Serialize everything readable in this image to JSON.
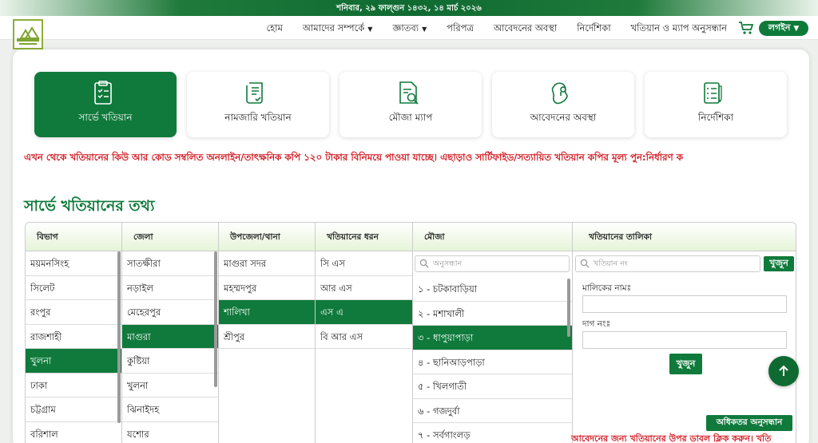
{
  "header": {
    "date": "শনিবার, ২৯ ফাল্গুন ১৪৩২, ১৪ মার্চ ২০২৬",
    "nav": [
      {
        "label": "হোম",
        "dropdown": false
      },
      {
        "label": "আমাদের সম্পর্কে",
        "dropdown": true
      },
      {
        "label": "জ্ঞাতব্য",
        "dropdown": true
      },
      {
        "label": "পরিপত্র",
        "dropdown": false
      },
      {
        "label": "আবেদনের অবস্থা",
        "dropdown": false
      },
      {
        "label": "নির্দেশিকা",
        "dropdown": false
      },
      {
        "label": "খতিয়ান ও ম্যাপ অনুসন্ধান",
        "dropdown": false
      }
    ],
    "login_label": "লগইন"
  },
  "cards": [
    {
      "label": "সার্ভে খতিয়ান",
      "active": true,
      "icon": "survey-clipboard-icon"
    },
    {
      "label": "নামজারি খতিয়ান",
      "active": false,
      "icon": "mutation-scroll-icon"
    },
    {
      "label": "মৌজা ম্যাপ",
      "active": false,
      "icon": "map-search-icon"
    },
    {
      "label": "আবেদনের অবস্থা",
      "active": false,
      "icon": "location-map-icon"
    },
    {
      "label": "নির্দেশিকা",
      "active": false,
      "icon": "checklist-icon"
    }
  ],
  "ticker": "এখন থেকে খতিয়ানের কিউ আর কোড সম্বলিত অনলাইন/তাৎক্ষনিক কপি ১২০ টাকার বিনিময়ে পাওয়া যাচ্ছে। এছাড়াও সার্টিফাইড/সত্যায়িত খতিয়ান কপির মূল্য পুন:নির্ধারণ ক",
  "section_title": "সার্ভে খতিয়ানের তথ্য",
  "columns": {
    "division": {
      "header": "বিভাগ",
      "items": [
        "ময়মনসিংহ",
        "সিলেট",
        "রংপুর",
        "রাজশাহী",
        "খুলনা",
        "ঢাকা",
        "চট্টগ্রাম",
        "বরিশাল"
      ],
      "selected": 4
    },
    "district": {
      "header": "জেলা",
      "items": [
        "সাতক্ষীরা",
        "নড়াইল",
        "মেহেরপুর",
        "মাগুরা",
        "কুষ্টিয়া",
        "খুলনা",
        "ঝিনাইদহ",
        "যশোর"
      ],
      "selected": 3
    },
    "upazila": {
      "header": "উপজেলা/থানা",
      "items": [
        "মাগুরা সদর",
        "মহম্মদপুর",
        "শালিখা",
        "শ্রীপুর"
      ],
      "selected": 2
    },
    "type": {
      "header": "খতিয়ানের ধরন",
      "items": [
        "সি এস",
        "আর এস",
        "এস এ",
        "বি আর এস"
      ],
      "selected": 2
    },
    "mouza": {
      "header": "মৌজা",
      "search_placeholder": "অনুসন্ধান",
      "items": [
        "১ - চটকাবাড়িয়া",
        "২ - মশাখালী",
        "৩ - ধাপুয়াপাড়া",
        "৪ - ছানিআড়পাড়া",
        "৫ - খিলগাতী",
        "৬ - গজদুর্বা",
        "৭ - সর্বগাংলড়"
      ],
      "selected": 2
    },
    "khatian": {
      "header": "খতিয়ানের তালিকা",
      "search_placeholder": "খতিয়ান নং",
      "search_button": "খুজুন",
      "owner_label": "মালিকের নামঃ",
      "dag_label": "দাগ নংঃ",
      "submit_button": "খুজুন",
      "advanced_button": "অধিকতর অনুসন্ধান"
    }
  },
  "double_click_hint": "আবেদনের জন্য খতিয়ানের উপর ডাবল ক্লিক করুন। খতি",
  "colors": {
    "brand_green": "#0f7a3b",
    "alert_red": "#d21f26"
  }
}
